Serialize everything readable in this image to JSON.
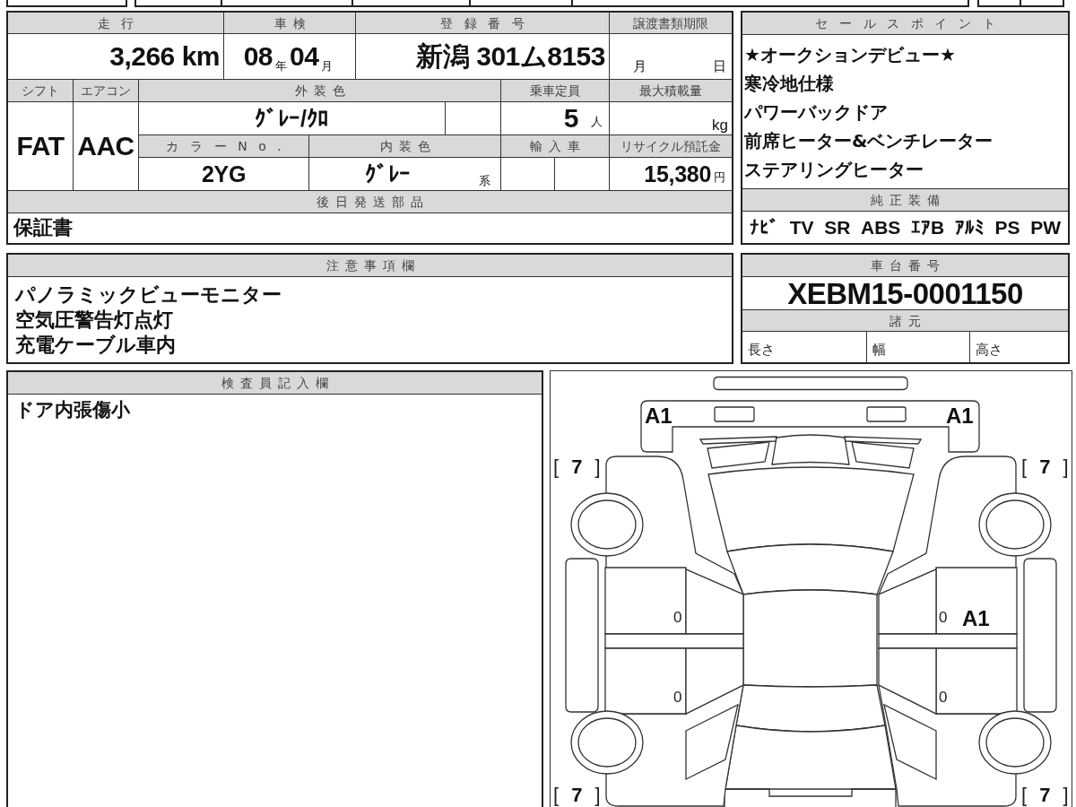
{
  "vehicle_info": {
    "mileage": {
      "label": "走行",
      "value": "3,266 km"
    },
    "inspection": {
      "label": "車検",
      "year": "08",
      "year_unit": "年",
      "month": "04",
      "month_unit": "月"
    },
    "registration": {
      "label": "登録番号",
      "value": "新潟 301ム8153"
    },
    "transfer_deadline": {
      "label": "譲渡書類期限",
      "month_unit": "月",
      "day_unit": "日"
    },
    "shift": {
      "label": "シフト",
      "value": "FAT"
    },
    "air_conditioner": {
      "label": "エアコン",
      "value": "AAC"
    },
    "exterior_color": {
      "label": "外装色",
      "value": "ｸﾞﾚｰ/ｸﾛ"
    },
    "capacity": {
      "label": "乗車定員",
      "value": "5",
      "unit": "人"
    },
    "max_load": {
      "label": "最大積載量",
      "unit": "kg"
    },
    "color_no": {
      "label": "カラーNo.",
      "value": "2YG"
    },
    "interior_color": {
      "label": "内装色",
      "value": "ｸﾞﾚｰ",
      "suffix": "系"
    },
    "imported": {
      "label": "輸入車"
    },
    "recycle_deposit": {
      "label": "リサイクル預託金",
      "value": "15,380",
      "unit": "円"
    },
    "later_parts": {
      "label": "後日発送部品",
      "value": "保証書"
    }
  },
  "sales_points": {
    "title": "セールスポイント",
    "items": [
      "★オークションデビュー★",
      "寒冷地仕様",
      "パワーバックドア",
      "前席ヒーター&ベンチレーター",
      "ステアリングヒーター"
    ]
  },
  "equipment": {
    "title": "純正装備",
    "items": [
      "ﾅﾋﾞ",
      "TV",
      "SR",
      "ABS",
      "ｴｱB",
      "ｱﾙﾐ",
      "PS",
      "PW"
    ]
  },
  "notes": {
    "title": "注意事項欄",
    "lines": [
      "パノラミックビューモニター",
      "空気圧警告灯点灯",
      "充電ケーブル車内"
    ]
  },
  "chassis": {
    "title": "車台番号",
    "value": "XEBM15-0001150"
  },
  "dimensions": {
    "title": "諸元",
    "fields": [
      "長さ",
      "幅",
      "高さ"
    ]
  },
  "inspector_notes": {
    "title": "検査員記入欄",
    "lines": [
      "ドア内張傷小"
    ]
  },
  "car_diagram": {
    "damage_marks": [
      "A1",
      "A1",
      "A1"
    ],
    "tire_readings": [
      "[ **7** ]",
      "[ **7** ]",
      "[ **7** ]",
      "[ **7** ]"
    ],
    "door_readings": [
      "0",
      "0",
      "0",
      "0"
    ]
  }
}
